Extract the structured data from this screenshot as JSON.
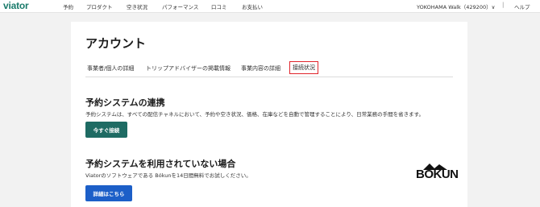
{
  "header": {
    "logo": "viator",
    "nav": [
      "予約",
      "プロダクト",
      "空き状況",
      "パフォーマンス",
      "口コミ",
      "お支払い"
    ],
    "account": "YOKOHAMA Walk（429200）∨",
    "separator": "|",
    "help": "ヘルプ"
  },
  "page": {
    "title": "アカウント",
    "tabs": [
      "事業者/個人の詳細",
      "トリップアドバイザーの掲載情報",
      "事業内容の詳細",
      "接続状況"
    ],
    "active_tab": "接続状況"
  },
  "sections": {
    "connect": {
      "title": "予約システムの連携",
      "desc": "予約システムは、すべての配信チャネルにおいて、予約や空き状況、価格、在庫などを自動で管理することにより、日常業務の手間を省きます。",
      "button": "今すぐ接続"
    },
    "noSystem": {
      "title": "予約システムを利用されていない場合",
      "desc": "Viatorのソフトウェアである Bókunを14日間無料でお試しください。",
      "button": "詳細はこちら",
      "logo_text": "BÓKUN"
    }
  },
  "colors": {
    "brand": "#1a7b6b",
    "connect_button": "#1e6b63",
    "details_button": "#1c5fc8",
    "active_tab_border": "#e0242b"
  }
}
